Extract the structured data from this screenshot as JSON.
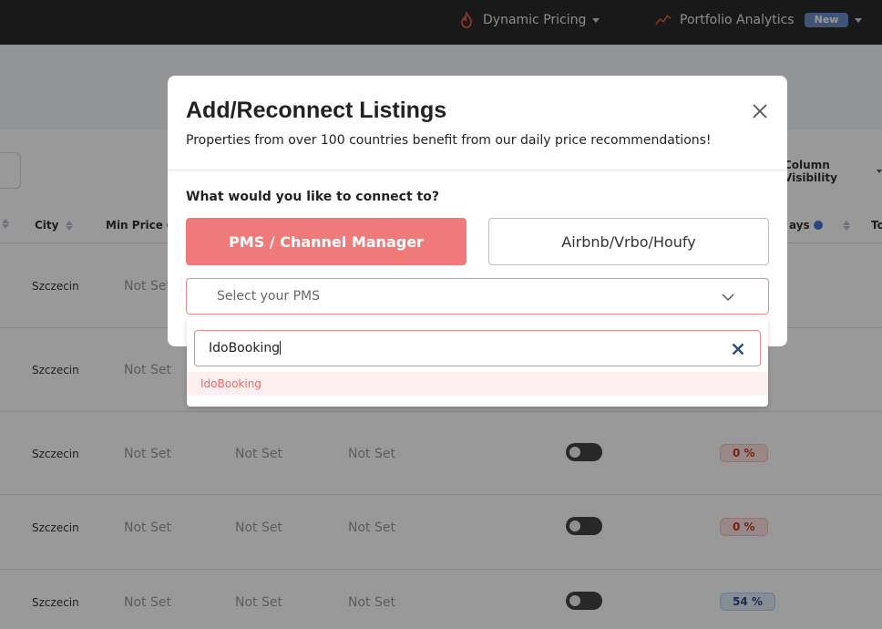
{
  "nav": {
    "dynamic_pricing": "Dynamic Pricing",
    "portfolio_analytics": "Portfolio Analytics",
    "new_badge": "New",
    "icons": [
      "flame-icon",
      "trend-chart-icon"
    ]
  },
  "table": {
    "column_visibility": "Column Visibility",
    "headers": {
      "city": "City",
      "min_price": "Min Price",
      "days_suffix": "ays",
      "total_prefix": "To"
    },
    "rows": [
      {
        "city": "Szczecin",
        "min_price": "Not Set"
      },
      {
        "city": "Szczecin",
        "min_price": "Not Set"
      },
      {
        "city": "Szczecin",
        "min_price": "Not Set",
        "c2": "Not Set",
        "c3": "Not Set",
        "pct": "0 %"
      },
      {
        "city": "Szczecin",
        "min_price": "Not Set",
        "c2": "Not Set",
        "c3": "Not Set",
        "pct": "0 %"
      },
      {
        "city": "Szczecin",
        "min_price": "Not Set",
        "c2": "Not Set",
        "c3": "Not Set",
        "pct": "54 %"
      }
    ]
  },
  "modal": {
    "title": "Add/Reconnect Listings",
    "subtitle": "Properties from over 100 countries benefit from our daily price recommendations!",
    "question": "What would you like to connect to?",
    "option_pms": "PMS / Channel Manager",
    "option_airbnb": "Airbnb/Vrbo/Houfy",
    "select_placeholder": "Select your PMS",
    "search_value": "IdoBooking",
    "result": "IdoBooking"
  },
  "colors": {
    "accent": "#f07a7a",
    "accent_text": "#e66b6b",
    "nav_bg": "#2b2b2b",
    "badge": "#6b8cc9"
  }
}
